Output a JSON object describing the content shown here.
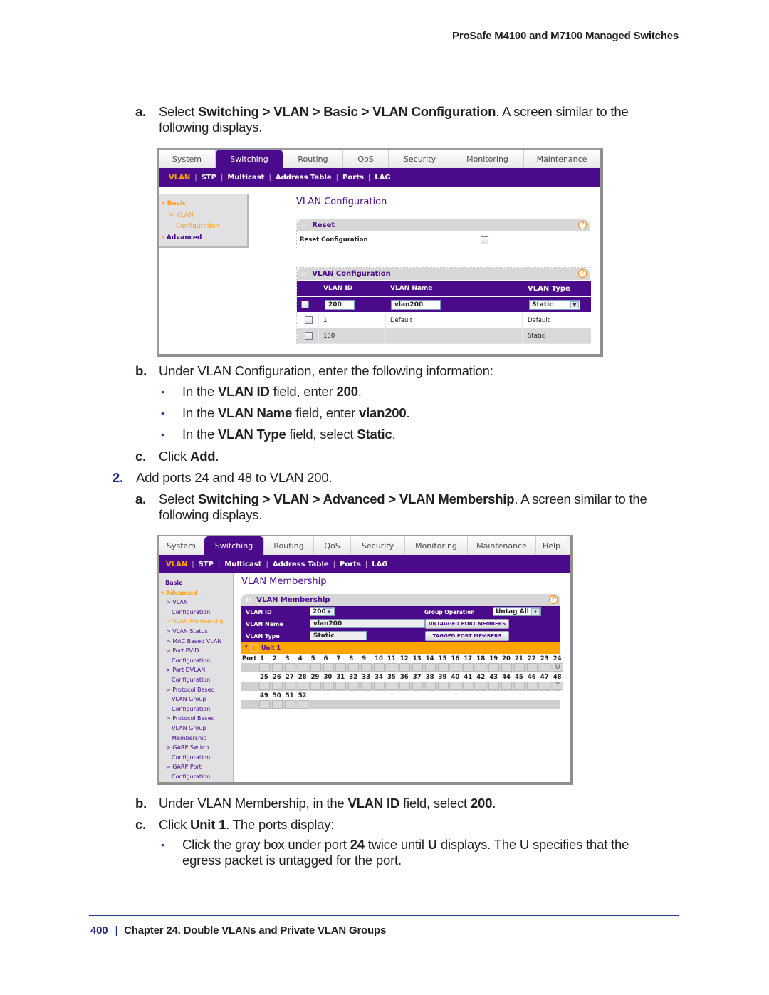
{
  "running_head": "ProSafe M4100 and M7100 Managed Switches",
  "steps": {
    "s1a": {
      "label": "a.",
      "pre": "Select ",
      "path": "Switching > VLAN > Basic > VLAN Configuration",
      "post": ". A screen similar to the",
      "line2": "following displays."
    },
    "s1b": {
      "label": "b.",
      "text": "Under VLAN Configuration, enter the following information:"
    },
    "b1": {
      "pre": "In the ",
      "field": "VLAN ID",
      "mid": " field, enter ",
      "value": "200",
      "post": "."
    },
    "b2": {
      "pre": "In the ",
      "field": "VLAN Name",
      "mid": " field, enter ",
      "value": "vlan200",
      "post": "."
    },
    "b3": {
      "pre": "In the ",
      "field": "VLAN Type",
      "mid": " field, select ",
      "value": "Static",
      "post": "."
    },
    "s1c": {
      "label": "c.",
      "pre": "Click ",
      "value": "Add",
      "post": "."
    },
    "s2": {
      "label": "2.",
      "text": "Add ports 24 and 48 to VLAN 200."
    },
    "s2a": {
      "label": "a.",
      "pre": "Select ",
      "path": "Switching > VLAN > Advanced > VLAN Membership",
      "post": ". A screen similar to the",
      "line2": "following displays."
    },
    "s2b": {
      "label": "b.",
      "pre": "Under VLAN Membership, in the ",
      "field": "VLAN ID",
      "mid": " field, select ",
      "value": "200",
      "post": "."
    },
    "s2c": {
      "label": "c.",
      "pre": "Click ",
      "value": "Unit 1",
      "post": ". The ports display:"
    },
    "b4": {
      "pre": "Click the gray box under port ",
      "port": "24",
      "mid": " twice until ",
      "value": "U",
      "post": " displays. The U specifies that the",
      "line2": "egress packet is untagged for the port."
    }
  },
  "screen1": {
    "tabs": [
      "System",
      "Switching",
      "Routing",
      "QoS",
      "Security",
      "Monitoring",
      "Maintenance"
    ],
    "active_tab": "Switching",
    "subnav": [
      "VLAN",
      "STP",
      "Multicast",
      "Address Table",
      "Ports",
      "LAG"
    ],
    "leftnav": {
      "basic": "Basic",
      "vlan": "> VLAN",
      "config": "Configuration",
      "advanced": "Advanced"
    },
    "title": "VLAN Configuration",
    "reset_box": {
      "title": "Reset",
      "row_label": "Reset Configuration",
      "help": "?"
    },
    "config_box": {
      "title": "VLAN Configuration",
      "help": "?",
      "columns": [
        "VLAN ID",
        "VLAN Name",
        "VLAN Type"
      ],
      "input_row": {
        "vlan_id": "200",
        "vlan_name": "vlan200",
        "vlan_type": "Static"
      },
      "rows": [
        {
          "id": "1",
          "name": "Default",
          "type": "Default"
        },
        {
          "id": "100",
          "name": "",
          "type": "Static"
        }
      ]
    }
  },
  "screen2": {
    "tabs": [
      "System",
      "Switching",
      "Routing",
      "QoS",
      "Security",
      "Monitoring",
      "Maintenance",
      "Help"
    ],
    "active_tab": "Switching",
    "subnav": [
      "VLAN",
      "STP",
      "Multicast",
      "Address Table",
      "Ports",
      "LAG"
    ],
    "leftnav": [
      {
        "text": "Basic",
        "color": "purple",
        "kind": "section"
      },
      {
        "text": "Advanced",
        "color": "orange",
        "kind": "section"
      },
      {
        "text": "> VLAN",
        "color": "purple"
      },
      {
        "text": "Configuration",
        "color": "purple",
        "indent": true
      },
      {
        "text": "> VLAN Membership",
        "color": "orange"
      },
      {
        "text": "> VLAN Status",
        "color": "purple"
      },
      {
        "text": "> MAC Based VLAN",
        "color": "purple"
      },
      {
        "text": "> Port PVID",
        "color": "purple"
      },
      {
        "text": "Configuration",
        "color": "purple",
        "indent": true
      },
      {
        "text": "> Port DVLAN",
        "color": "purple"
      },
      {
        "text": "Configuration",
        "color": "purple",
        "indent": true
      },
      {
        "text": "> Protocol Based",
        "color": "purple"
      },
      {
        "text": "VLAN Group",
        "color": "purple",
        "indent": true
      },
      {
        "text": "Configuration",
        "color": "purple",
        "indent": true
      },
      {
        "text": "> Protocol Based",
        "color": "purple"
      },
      {
        "text": "VLAN Group",
        "color": "purple",
        "indent": true
      },
      {
        "text": "Membership",
        "color": "purple",
        "indent": true
      },
      {
        "text": "> GARP Switch",
        "color": "purple"
      },
      {
        "text": "Configuration",
        "color": "purple",
        "indent": true
      },
      {
        "text": "> GARP Port",
        "color": "purple"
      },
      {
        "text": "Configuration",
        "color": "purple",
        "indent": true
      }
    ],
    "title": "VLAN Membership",
    "box": {
      "title": "VLAN Membership",
      "help": "?",
      "vlan_id_label": "VLAN ID",
      "vlan_id_value": "200",
      "group_op_label": "Group Operation",
      "group_op_value": "Untag All",
      "vlan_name_label": "VLAN Name",
      "vlan_name_value": "vlan200",
      "vlan_type_label": "VLAN Type",
      "vlan_type_value": "Static",
      "untagged_btn": "UNTAGGED PORT MEMBERS",
      "tagged_btn": "TAGGED PORT MEMBERS",
      "unit_label": "Unit 1",
      "port_label": "Port",
      "port_rows": [
        {
          "ports": [
            "1",
            "2",
            "3",
            "4",
            "5",
            "6",
            "7",
            "8",
            "9",
            "10",
            "11",
            "12",
            "13",
            "14",
            "15",
            "16",
            "17",
            "18",
            "19",
            "20",
            "21",
            "22",
            "23",
            "24"
          ],
          "marks": {
            "24": "U"
          }
        },
        {
          "ports": [
            "25",
            "26",
            "27",
            "28",
            "29",
            "30",
            "31",
            "32",
            "33",
            "34",
            "35",
            "36",
            "37",
            "38",
            "39",
            "40",
            "41",
            "42",
            "43",
            "44",
            "45",
            "46",
            "47",
            "48"
          ],
          "marks": {
            "48": "T"
          }
        },
        {
          "ports": [
            "49",
            "50",
            "51",
            "52"
          ],
          "marks": {}
        }
      ]
    }
  },
  "footer": {
    "page": "400",
    "separator": "|",
    "chapter": "Chapter 24.  Double VLANs and Private VLAN Groups"
  },
  "colors": {
    "nav_purple": "#4b0a8c",
    "nav_orange": "#ffa500",
    "doc_blue": "#2b3990"
  }
}
